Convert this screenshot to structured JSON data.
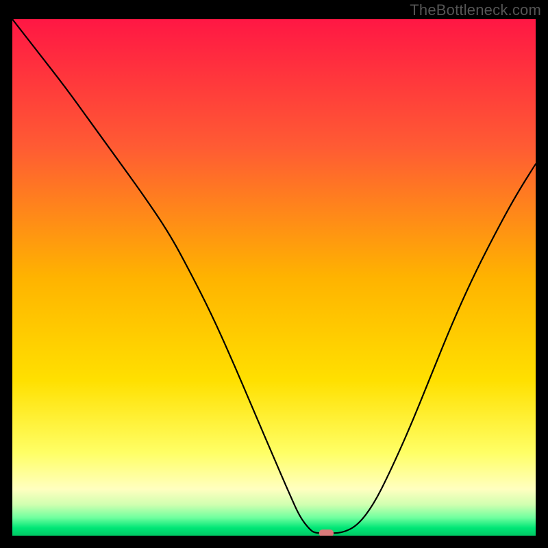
{
  "watermark": "TheBottleneck.com",
  "chart_data": {
    "type": "line",
    "title": "",
    "xlabel": "",
    "ylabel": "",
    "xlim": [
      0,
      100
    ],
    "ylim": [
      0,
      100
    ],
    "background_gradient": {
      "stops": [
        {
          "offset": 0,
          "color": "#ff1744"
        },
        {
          "offset": 25,
          "color": "#ff5c33"
        },
        {
          "offset": 50,
          "color": "#ffb300"
        },
        {
          "offset": 70,
          "color": "#ffe000"
        },
        {
          "offset": 84,
          "color": "#ffff66"
        },
        {
          "offset": 91,
          "color": "#ffffc0"
        },
        {
          "offset": 94,
          "color": "#d0ffb0"
        },
        {
          "offset": 96.5,
          "color": "#70ff9f"
        },
        {
          "offset": 98.5,
          "color": "#00e676"
        },
        {
          "offset": 100,
          "color": "#00c864"
        }
      ]
    },
    "series": [
      {
        "name": "bottleneck-curve",
        "color": "#000000",
        "width": 2.2,
        "x": [
          0,
          5,
          10,
          15,
          20,
          25,
          30,
          34,
          38,
          42,
          46,
          50,
          53,
          55,
          57,
          58,
          60,
          63,
          66,
          69,
          72,
          76,
          80,
          84,
          88,
          92,
          96,
          100
        ],
        "y": [
          100,
          93.5,
          87,
          80,
          73,
          66,
          58.5,
          51,
          43,
          34,
          24.5,
          15,
          8,
          3.5,
          1,
          0.5,
          0.5,
          0.5,
          2,
          6,
          12,
          21,
          31,
          41,
          50,
          58,
          65.5,
          72
        ]
      }
    ],
    "marker": {
      "name": "optimal-point",
      "x": 60,
      "y": 0.5,
      "color": "#d97a7a",
      "width": 2.8,
      "height": 1.4
    }
  }
}
